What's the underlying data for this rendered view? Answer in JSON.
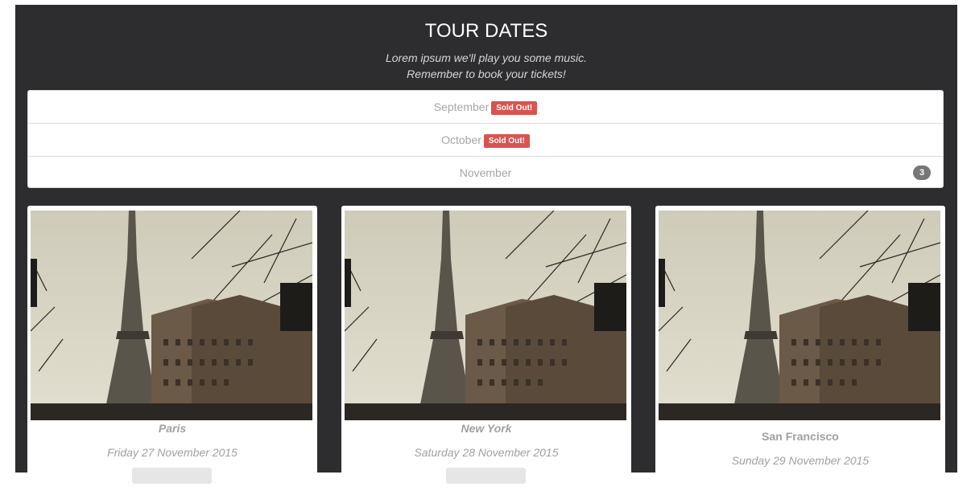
{
  "header": {
    "title": "TOUR DATES",
    "subtitle_line1": "Lorem ipsum we'll play you some music.",
    "subtitle_line2": "Remember to book your tickets!"
  },
  "months": [
    {
      "label": "September",
      "badge": "Sold Out!"
    },
    {
      "label": "October",
      "badge": "Sold Out!"
    },
    {
      "label": "November",
      "count": "3"
    }
  ],
  "cards": [
    {
      "city": "Paris",
      "date": "Friday 27 November 2015",
      "image_icon": "eiffel-tower-photo"
    },
    {
      "city": "New York",
      "date": "Saturday 28 November 2015",
      "image_icon": "eiffel-tower-photo"
    },
    {
      "city": "San Francisco",
      "date": "Sunday 29 November 2015",
      "image_icon": "eiffel-tower-photo"
    }
  ],
  "colors": {
    "section_bg": "#2d2d30",
    "sold_badge": "#d9534f",
    "count_badge": "#777777"
  }
}
